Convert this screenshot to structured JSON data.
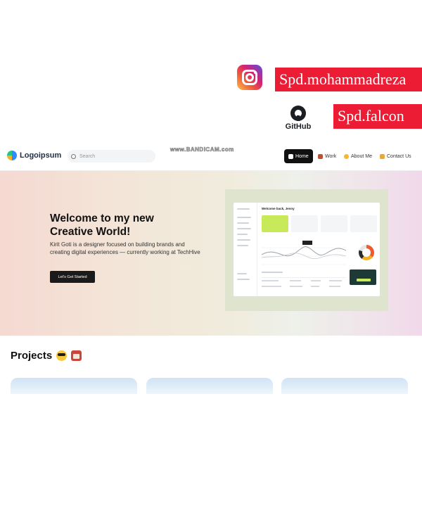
{
  "overlay": {
    "instagram_handle": "Spd.mohammadreza",
    "github_word": "GitHub",
    "github_handle": "Spd.falcon"
  },
  "nav": {
    "logo": "Logoipsum",
    "search_placeholder": "Search",
    "watermark": "www.BANDICAM.com",
    "items": [
      {
        "label": "Home",
        "icon": "home-icon",
        "active": true
      },
      {
        "label": "Work",
        "icon": "briefcase-icon",
        "active": false
      },
      {
        "label": "About Me",
        "icon": "smile-icon",
        "active": false
      },
      {
        "label": "Contact Us",
        "icon": "contact-icon",
        "active": false
      }
    ]
  },
  "hero": {
    "title": "Welcome to my new Creative World!",
    "description": "Kirit Goti is a designer focused on building brands and creating digital experiences — currently working at TechHive",
    "cta": "Let's Get Started",
    "mock_greeting": "Welcome back, Jenny"
  },
  "projects": {
    "title": "Projects",
    "emoji": [
      "cool-face-emoji",
      "briefcase-emoji"
    ]
  },
  "colors": {
    "tag_red": "#ec1c35",
    "nav_active": "#111111",
    "lime_accent": "#c8ea5a"
  }
}
